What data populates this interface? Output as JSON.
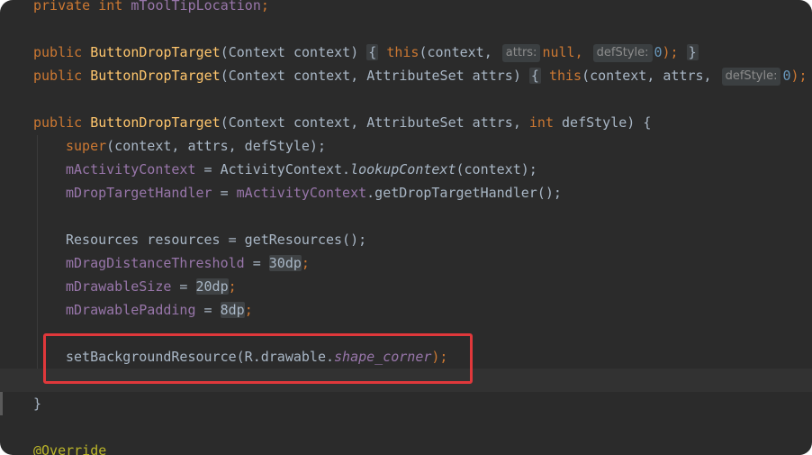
{
  "lines": {
    "l0": {
      "kw": "private int ",
      "field": "mToolTipLocation",
      "end": ";"
    },
    "l1": {
      "kw": "public ",
      "fn": "ButtonDropTarget",
      "params": "(Context context) ",
      "ob": "{",
      "sp1": " ",
      "this": "this",
      "args": "(context, ",
      "hint1": "attrs:",
      "null": "null",
      "c1": ", ",
      "hint2": "defStyle:",
      "zero": "0",
      "cl": "); ",
      "cb": "}"
    },
    "l2": {
      "kw": "public ",
      "fn": "ButtonDropTarget",
      "params": "(Context context, AttributeSet attrs) ",
      "ob": "{",
      "sp1": " ",
      "this": "this",
      "args": "(context, attrs, ",
      "hint2": "defStyle:",
      "zero": "0",
      "cl": ");"
    },
    "l3": {
      "kw": "public ",
      "fn": "ButtonDropTarget",
      "p1": "(Context context, AttributeSet attrs, ",
      "int": "int",
      "p2": " defStyle) {"
    },
    "l4": {
      "kw": "super",
      "rest": "(context, attrs, defStyle);"
    },
    "l5": {
      "field": "mActivityContext",
      "eq": " = ActivityContext.",
      "call": "lookupContext",
      "rest": "(context);"
    },
    "l6": {
      "field": "mDropTargetHandler",
      "eq": " = ",
      "field2": "mActivityContext",
      "rest": ".getDropTargetHandler();"
    },
    "l7": {
      "text": "Resources resources = getResources();"
    },
    "l8": {
      "field": "mDragDistanceThreshold",
      "eq": " = ",
      "val": "30dp",
      "end": ";"
    },
    "l9": {
      "field": "mDrawableSize",
      "eq": " = ",
      "val": "20dp",
      "end": ";"
    },
    "l10": {
      "field": "mDrawablePadding",
      "eq": " = ",
      "val": "8dp",
      "end": ";"
    },
    "l11": {
      "pre": "setBackgroundResource(R.drawable.",
      "res": "shape_corner",
      "end": ");"
    },
    "l12": {
      "text": "}"
    },
    "l13": {
      "text": "@Override"
    }
  }
}
